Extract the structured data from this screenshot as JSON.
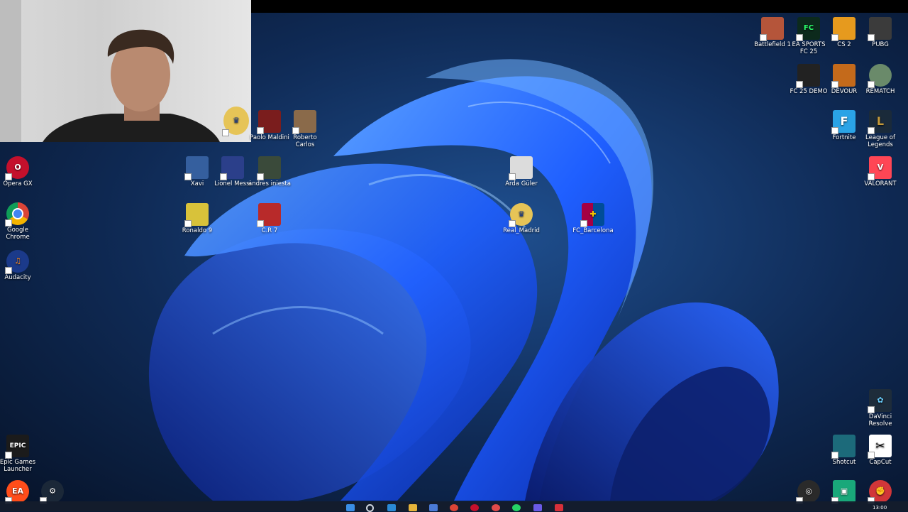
{
  "desktop": {
    "icons_left": [
      {
        "label": "Opera GX",
        "icon": "opera-gx-icon",
        "color": "#c4102c"
      },
      {
        "label": "Google Chrome",
        "icon": "chrome-icon",
        "color": "#e8e8e8"
      },
      {
        "label": "Audacity",
        "icon": "audacity-icon",
        "color": "#1b3a8a"
      },
      {
        "label": "Epic Games Launcher",
        "icon": "epic-games-icon",
        "color": "#1b1b1b"
      }
    ],
    "icons_mid": [
      {
        "label": "Paolo Maldini",
        "icon": "photo-icon",
        "color": "#7a1d1d"
      },
      {
        "label": "Roberto Carlos",
        "icon": "photo-icon",
        "color": "#8a6a4a"
      },
      {
        "label": "Xavi",
        "icon": "photo-icon",
        "color": "#355f9e"
      },
      {
        "label": "Lionel Messi",
        "icon": "photo-icon",
        "color": "#2b3f8a"
      },
      {
        "label": "andres iniesta",
        "icon": "photo-icon",
        "color": "#3a4a3a"
      },
      {
        "label": "Ronaldo 9",
        "icon": "photo-icon",
        "color": "#d8c23a"
      },
      {
        "label": "C.R 7",
        "icon": "photo-icon",
        "color": "#b82a2a"
      },
      {
        "label": "Arda Güler",
        "icon": "photo-icon",
        "color": "#dcdcdc"
      },
      {
        "label": "Real_Madrid",
        "icon": "real-madrid-crest-icon",
        "color": "#e6c457"
      },
      {
        "label": "FC_Barcelona",
        "icon": "fc-barcelona-crest-icon",
        "color": "#a50044"
      }
    ],
    "icons_right": [
      {
        "label": "Battlefield 1",
        "icon": "battlefield-icon",
        "color": "#b5553a"
      },
      {
        "label": "EA SPORTS FC 25",
        "icon": "ea-fc-icon",
        "color": "#0c2a1c"
      },
      {
        "label": "CS 2",
        "icon": "cs2-icon",
        "color": "#e69a1e"
      },
      {
        "label": "PUBG",
        "icon": "pubg-icon",
        "color": "#3b3b3b"
      },
      {
        "label": "FC 25 DEMO",
        "icon": "fc25-demo-icon",
        "color": "#222"
      },
      {
        "label": "DEVOUR",
        "icon": "devour-icon",
        "color": "#c46a1b"
      },
      {
        "label": "REMATCH",
        "icon": "rematch-icon",
        "color": "#6a8a6a"
      },
      {
        "label": "Fortnite",
        "icon": "fortnite-icon",
        "color": "#2aa3e6"
      },
      {
        "label": "League of Legends",
        "icon": "lol-icon",
        "color": "#c69b3a"
      },
      {
        "label": "VALORANT",
        "icon": "valorant-icon",
        "color": "#ff4655"
      },
      {
        "label": "DaVinci Resolve",
        "icon": "davinci-icon",
        "color": "#1e2c3a"
      },
      {
        "label": "Shotcut",
        "icon": "shotcut-icon",
        "color": "#1c6a7a"
      },
      {
        "label": "CapCut",
        "icon": "capcut-icon",
        "color": "#ffffff"
      }
    ],
    "bottom_row": [
      {
        "icon": "ea-app-icon",
        "color": "#ff4d1a"
      },
      {
        "icon": "steam-icon",
        "color": "#1b2838"
      },
      {
        "icon": "obs-icon",
        "color": "#2a2a2a"
      },
      {
        "icon": "twitch-studio-icon",
        "color": "#19a87a"
      },
      {
        "icon": "riot-client-icon",
        "color": "#d13639"
      }
    ]
  },
  "taskbar": {
    "clock": "13:00",
    "items": [
      {
        "icon": "windows-start-icon",
        "color": "#3a8ee6"
      },
      {
        "icon": "search-icon",
        "color": "#cfd6e0"
      },
      {
        "icon": "edge-icon",
        "color": "#2a8ad6"
      },
      {
        "icon": "file-explorer-icon",
        "color": "#e6b43a"
      },
      {
        "icon": "store-icon",
        "color": "#4a7ad6"
      },
      {
        "icon": "chrome-icon",
        "color": "#db4437"
      },
      {
        "icon": "opera-gx-icon",
        "color": "#c4102c"
      },
      {
        "icon": "app-icon",
        "color": "#e04a4a"
      },
      {
        "icon": "whatsapp-icon",
        "color": "#25d366"
      },
      {
        "icon": "app-icon",
        "color": "#6a5ae6"
      },
      {
        "icon": "app-icon",
        "color": "#d6303a"
      }
    ]
  }
}
